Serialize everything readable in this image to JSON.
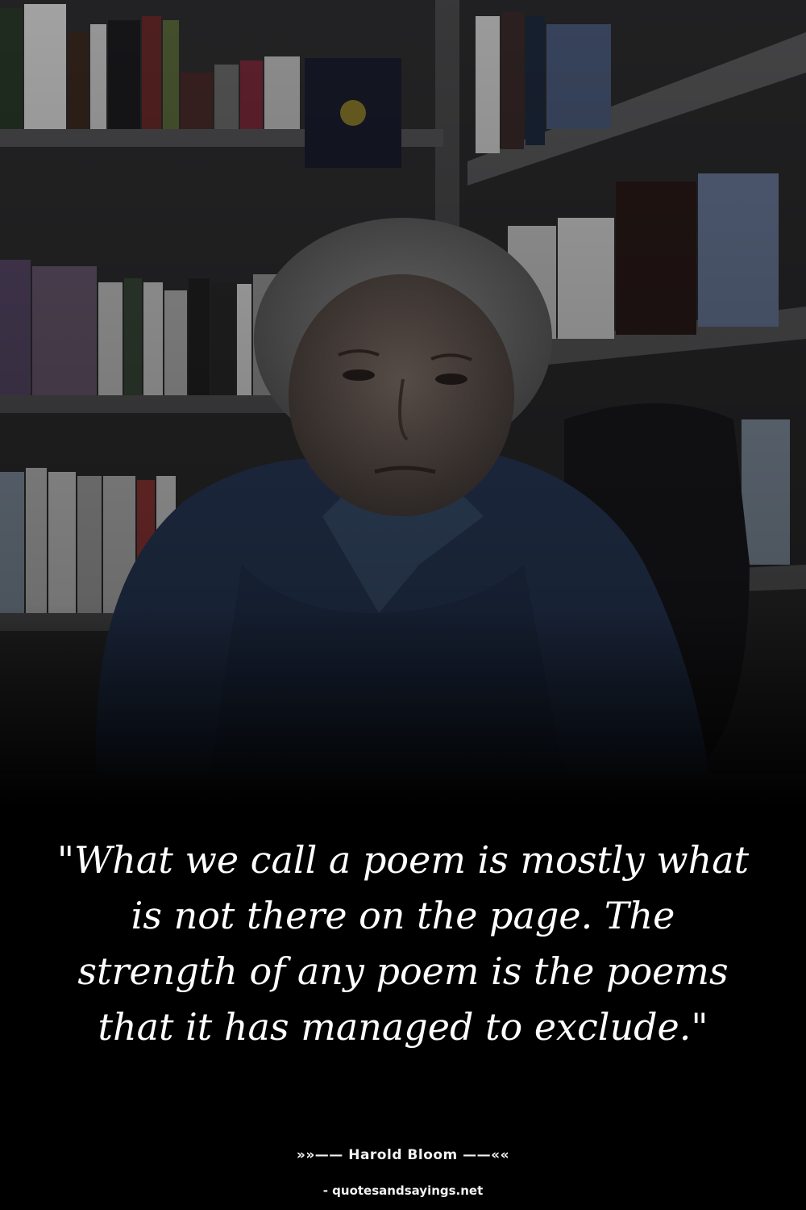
{
  "quote": {
    "text": "\"What we call a poem is mostly what is not there on the page. The strength of any poem is the poems that it has managed to exclude.\""
  },
  "attribution": {
    "author_line": "»»—— Harold Bloom ——««"
  },
  "watermark": {
    "site": "- quotesandsayings.net"
  },
  "colors": {
    "background": "#000000",
    "text": "#ffffff"
  }
}
